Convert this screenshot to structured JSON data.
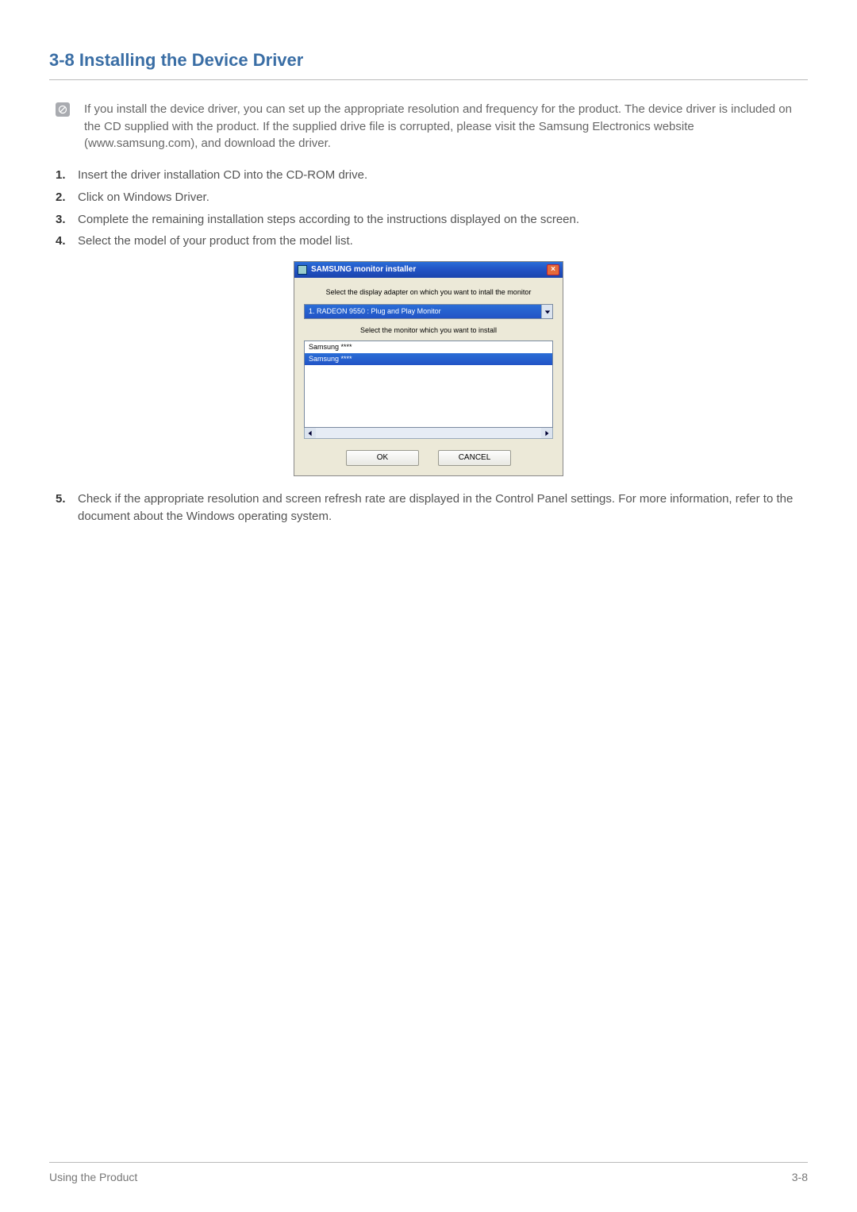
{
  "heading": "3-8    Installing the Device Driver",
  "note_text": "If you install the device driver, you can set up the appropriate resolution and frequency for the product. The device driver is included on the CD supplied with the product. If the supplied drive file is corrupted, please visit the Samsung Electronics website (www.samsung.com), and download the driver.",
  "steps": {
    "s1": "Insert the driver installation CD into the CD-ROM drive.",
    "s2": "Click on Windows Driver.",
    "s3": "Complete the remaining installation steps according to the instructions displayed on the screen.",
    "s4": "Select the model of your product from the model list.",
    "s5": "Check if the appropriate resolution and screen refresh rate are displayed in the Control Panel settings. For more information, refer to the document about the Windows operating system."
  },
  "dialog": {
    "title": "SAMSUNG monitor installer",
    "text1": "Select the display adapter on which you want to intall the monitor",
    "dropdown_selected": "1. RADEON 9550 : Plug and Play Monitor",
    "text2": "Select the monitor which you want to install",
    "list_item1": "Samsung ****",
    "list_item2": "Samsung ****",
    "ok_label": "OK",
    "cancel_label": "CANCEL"
  },
  "footer": {
    "left": "Using the Product",
    "right": "3-8"
  }
}
